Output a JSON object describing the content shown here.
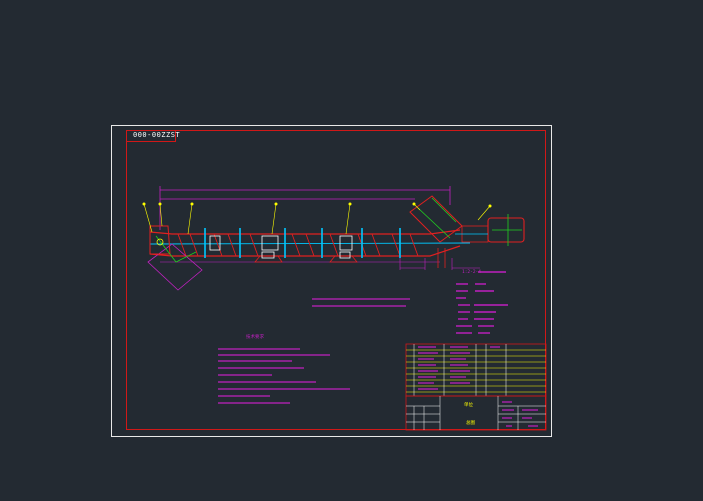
{
  "viewer": {
    "background": "#232a32",
    "sheet_border_color": "#e8e8e8",
    "frame_color": "#d01818"
  },
  "drawing": {
    "code": "000-00ZZST",
    "line_colors": {
      "frame": "#d01818",
      "dimension": "#c020c0",
      "centerline": "#00c8ff",
      "geometry": "#e02020",
      "leader": "#ffff00",
      "part": "#ffffff",
      "green": "#20d020"
    }
  },
  "tech_params": {
    "title": "1:2-2-4"
  },
  "notes": {
    "title": "技术要求"
  },
  "title_block": {
    "company": "单位",
    "drawing_name": "总图"
  }
}
